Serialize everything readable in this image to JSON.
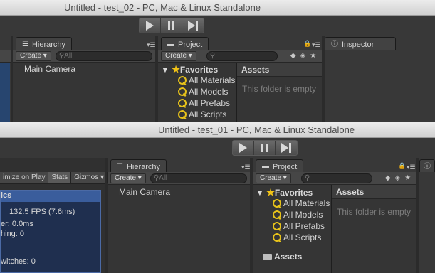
{
  "window_back": {
    "title": "Untitled - test_02 - PC, Mac & Linux Standalone",
    "hierarchy": {
      "tab": "Hierarchy",
      "create": "Create",
      "search_placeholder": "All",
      "items": [
        "Main Camera"
      ]
    },
    "project": {
      "tab": "Project",
      "create": "Create",
      "favorites": "Favorites",
      "fav_items": [
        "All Materials",
        "All Models",
        "All Prefabs",
        "All Scripts"
      ],
      "assets_header": "Assets",
      "empty_text": "This folder is empty"
    },
    "inspector": {
      "tab": "Inspector"
    }
  },
  "window_front": {
    "title": "Untitled - test_01 - PC, Mac & Linux Standalone",
    "game_toolbar": {
      "maximize": "imize on Play",
      "stats": "Stats",
      "gizmos": "Gizmos"
    },
    "stats": {
      "header": "ics",
      "fps": "132.5 FPS (7.6ms)",
      "line1": "er: 0.0ms",
      "line2": "hing: 0",
      "line3": "witches: 0"
    },
    "hierarchy": {
      "tab": "Hierarchy",
      "create": "Create",
      "search_placeholder": "All",
      "items": [
        "Main Camera"
      ]
    },
    "project": {
      "tab": "Project",
      "create": "Create",
      "favorites": "Favorites",
      "fav_items": [
        "All Materials",
        "All Models",
        "All Prefabs",
        "All Scripts"
      ],
      "assets_header": "Assets",
      "empty_text": "This folder is empty",
      "assets_folder": "Assets"
    }
  }
}
